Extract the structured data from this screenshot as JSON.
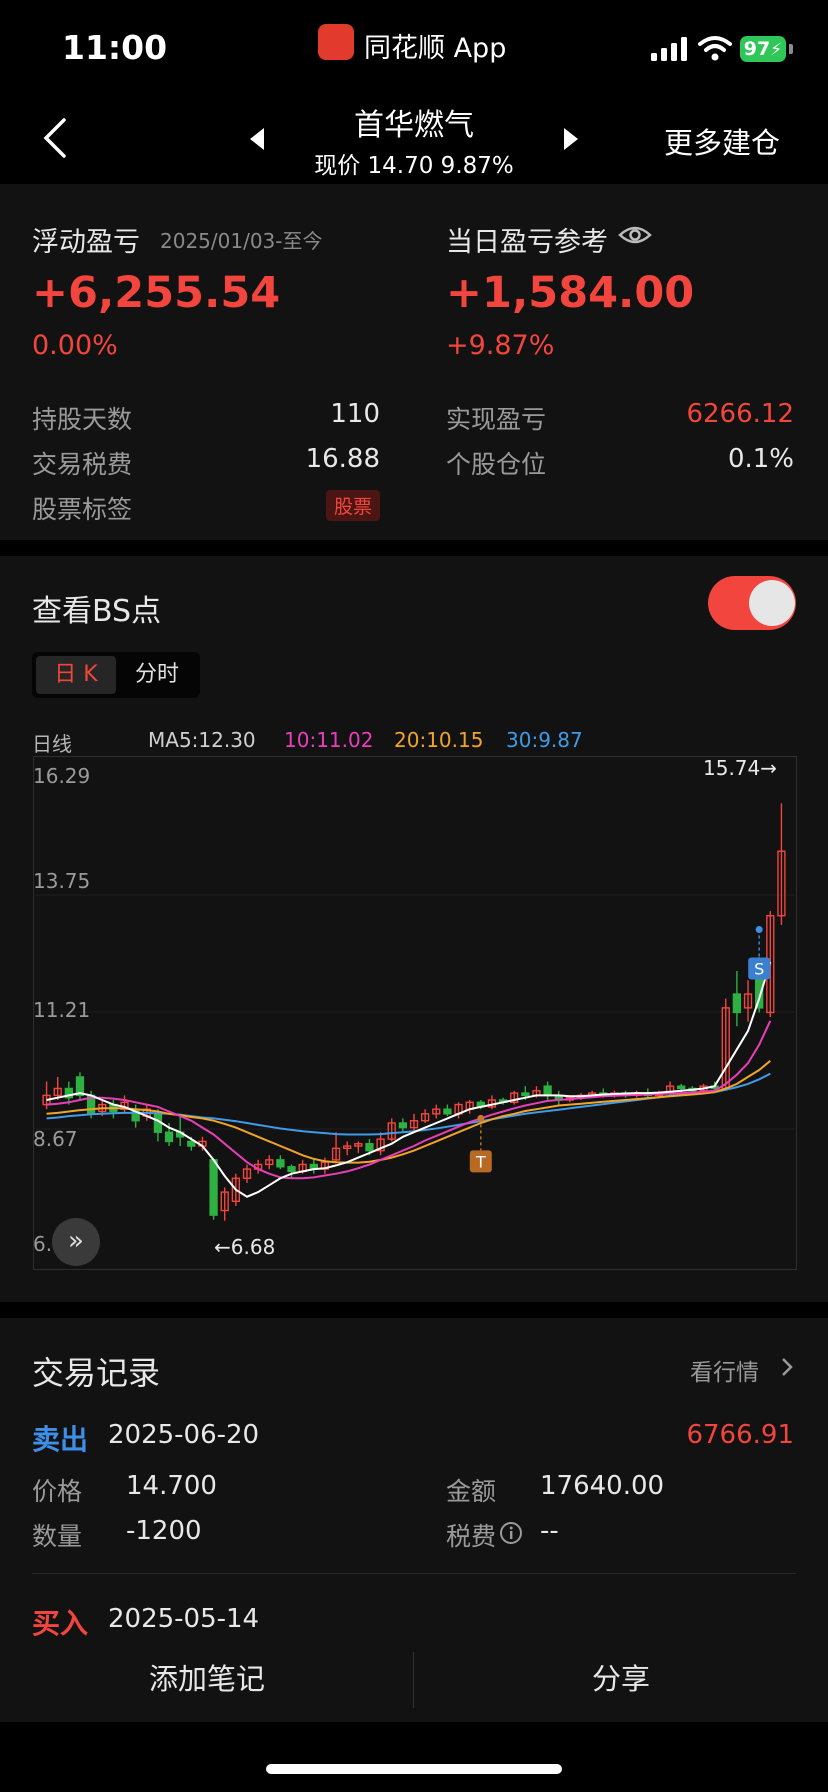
{
  "status": {
    "time": "11:00",
    "app_name": "同花顺 App",
    "battery": "97"
  },
  "nav": {
    "title": "首华燃气",
    "subtitle": "现价 14.70 9.87%",
    "more": "更多建仓"
  },
  "summary": {
    "float_label": "浮动盈亏",
    "date_range": "2025/01/03-至今",
    "float_value": "+6,255.54",
    "float_pct": "0.00%",
    "day_label": "当日盈亏参考",
    "day_value": "+1,584.00",
    "day_pct": "+9.87%",
    "rows_left": [
      {
        "label": "持股天数",
        "value": "110"
      },
      {
        "label": "交易税费",
        "value": "16.88"
      },
      {
        "label": "股票标签",
        "value": "股票"
      }
    ],
    "rows_right": [
      {
        "label": "实现盈亏",
        "value": "6266.12"
      },
      {
        "label": "个股仓位",
        "value": "0.1%"
      }
    ]
  },
  "bs": {
    "title": "查看BS点",
    "toggle_on": true,
    "tab_k": "日 K",
    "tab_time": "分时"
  },
  "ma": {
    "period": "日线",
    "ma5": "MA5:12.30",
    "ma10": "10:11.02",
    "ma20": "20:10.15",
    "ma30": "30:9.87"
  },
  "colors": {
    "up": "#f2453d",
    "down": "#2fb043",
    "ma5": "#ffffff",
    "ma10": "#e83fb8",
    "ma20": "#f0a42a",
    "ma30": "#3f9be8"
  },
  "chart_data": {
    "type": "candlestick",
    "y_ticks": [
      "16.29",
      "13.75",
      "11.21",
      "8.67",
      "6.1"
    ],
    "ylim": [
      6.13,
      16.29
    ],
    "high_label": "15.74→",
    "low_label": "←6.68",
    "markers": [
      {
        "label": "T",
        "index": 39,
        "price": 8.9
      },
      {
        "label": "S",
        "index": 64,
        "price": 13.0
      }
    ],
    "candles": [
      {
        "o": 9.2,
        "c": 9.4,
        "h": 9.7,
        "l": 9.1
      },
      {
        "o": 9.4,
        "c": 9.55,
        "h": 9.8,
        "l": 9.3
      },
      {
        "o": 9.55,
        "c": 9.35,
        "h": 9.7,
        "l": 9.2
      },
      {
        "o": 9.8,
        "c": 9.4,
        "h": 9.9,
        "l": 9.3
      },
      {
        "o": 9.4,
        "c": 9.0,
        "h": 9.5,
        "l": 8.9
      },
      {
        "o": 9.05,
        "c": 9.2,
        "h": 9.3,
        "l": 8.95
      },
      {
        "o": 9.2,
        "c": 9.05,
        "h": 9.3,
        "l": 8.9
      },
      {
        "o": 9.1,
        "c": 9.25,
        "h": 9.4,
        "l": 9.0
      },
      {
        "o": 9.1,
        "c": 8.85,
        "h": 9.2,
        "l": 8.7
      },
      {
        "o": 8.95,
        "c": 9.1,
        "h": 9.2,
        "l": 8.85
      },
      {
        "o": 9.0,
        "c": 8.6,
        "h": 9.1,
        "l": 8.4
      },
      {
        "o": 8.6,
        "c": 8.4,
        "h": 8.8,
        "l": 8.3
      },
      {
        "o": 8.6,
        "c": 8.5,
        "h": 9.0,
        "l": 8.3
      },
      {
        "o": 8.4,
        "c": 8.3,
        "h": 8.5,
        "l": 8.2
      },
      {
        "o": 8.3,
        "c": 8.4,
        "h": 8.5,
        "l": 8.2
      },
      {
        "o": 8.0,
        "c": 6.8,
        "h": 8.0,
        "l": 6.7
      },
      {
        "o": 6.9,
        "c": 7.3,
        "h": 7.4,
        "l": 6.68
      },
      {
        "o": 7.1,
        "c": 7.6,
        "h": 7.7,
        "l": 7.0
      },
      {
        "o": 7.6,
        "c": 7.8,
        "h": 7.9,
        "l": 7.5
      },
      {
        "o": 7.8,
        "c": 7.9,
        "h": 8.0,
        "l": 7.7
      },
      {
        "o": 7.9,
        "c": 8.0,
        "h": 8.1,
        "l": 7.8
      },
      {
        "o": 8.0,
        "c": 7.85,
        "h": 8.1,
        "l": 7.8
      },
      {
        "o": 7.85,
        "c": 7.75,
        "h": 7.9,
        "l": 7.6
      },
      {
        "o": 7.75,
        "c": 7.9,
        "h": 8.0,
        "l": 7.7
      },
      {
        "o": 7.9,
        "c": 7.8,
        "h": 8.0,
        "l": 7.7
      },
      {
        "o": 7.8,
        "c": 7.95,
        "h": 8.05,
        "l": 7.7
      },
      {
        "o": 8.0,
        "c": 8.25,
        "h": 8.6,
        "l": 7.95
      },
      {
        "o": 8.25,
        "c": 8.3,
        "h": 8.4,
        "l": 8.1
      },
      {
        "o": 8.3,
        "c": 8.35,
        "h": 8.4,
        "l": 8.15
      },
      {
        "o": 8.35,
        "c": 8.2,
        "h": 8.45,
        "l": 8.1
      },
      {
        "o": 8.2,
        "c": 8.45,
        "h": 8.6,
        "l": 8.1
      },
      {
        "o": 8.45,
        "c": 8.8,
        "h": 8.9,
        "l": 8.4
      },
      {
        "o": 8.8,
        "c": 8.7,
        "h": 8.9,
        "l": 8.6
      },
      {
        "o": 8.7,
        "c": 8.85,
        "h": 9.0,
        "l": 8.6
      },
      {
        "o": 8.85,
        "c": 9.0,
        "h": 9.1,
        "l": 8.8
      },
      {
        "o": 9.0,
        "c": 9.1,
        "h": 9.2,
        "l": 8.9
      },
      {
        "o": 9.1,
        "c": 9.0,
        "h": 9.2,
        "l": 8.95
      },
      {
        "o": 9.0,
        "c": 9.2,
        "h": 9.25,
        "l": 8.9
      },
      {
        "o": 9.1,
        "c": 9.25,
        "h": 9.3,
        "l": 9.0
      },
      {
        "o": 9.25,
        "c": 9.15,
        "h": 9.3,
        "l": 9.1
      },
      {
        "o": 9.15,
        "c": 9.3,
        "h": 9.4,
        "l": 9.1
      },
      {
        "o": 9.3,
        "c": 9.25,
        "h": 9.35,
        "l": 9.2
      },
      {
        "o": 9.25,
        "c": 9.45,
        "h": 9.5,
        "l": 9.2
      },
      {
        "o": 9.45,
        "c": 9.4,
        "h": 9.6,
        "l": 9.3
      },
      {
        "o": 9.4,
        "c": 9.5,
        "h": 9.6,
        "l": 9.35
      },
      {
        "o": 9.6,
        "c": 9.4,
        "h": 9.7,
        "l": 9.3
      },
      {
        "o": 9.4,
        "c": 9.3,
        "h": 9.5,
        "l": 9.2
      },
      {
        "o": 9.3,
        "c": 9.35,
        "h": 9.4,
        "l": 9.25
      },
      {
        "o": 9.35,
        "c": 9.4,
        "h": 9.45,
        "l": 9.3
      },
      {
        "o": 9.4,
        "c": 9.45,
        "h": 9.5,
        "l": 9.35
      },
      {
        "o": 9.45,
        "c": 9.4,
        "h": 9.55,
        "l": 9.35
      },
      {
        "o": 9.4,
        "c": 9.45,
        "h": 9.5,
        "l": 9.35
      },
      {
        "o": 9.45,
        "c": 9.4,
        "h": 9.5,
        "l": 9.35
      },
      {
        "o": 9.4,
        "c": 9.45,
        "h": 9.5,
        "l": 9.35
      },
      {
        "o": 9.45,
        "c": 9.4,
        "h": 9.55,
        "l": 9.35
      },
      {
        "o": 9.4,
        "c": 9.45,
        "h": 9.5,
        "l": 9.35
      },
      {
        "o": 9.45,
        "c": 9.6,
        "h": 9.7,
        "l": 9.4
      },
      {
        "o": 9.6,
        "c": 9.55,
        "h": 9.65,
        "l": 9.45
      },
      {
        "o": 9.55,
        "c": 9.5,
        "h": 9.6,
        "l": 9.45
      },
      {
        "o": 9.5,
        "c": 9.6,
        "h": 9.65,
        "l": 9.45
      },
      {
        "o": 9.6,
        "c": 9.55,
        "h": 9.7,
        "l": 9.5
      },
      {
        "o": 9.55,
        "c": 11.3,
        "h": 11.5,
        "l": 9.5
      },
      {
        "o": 11.6,
        "c": 11.2,
        "h": 12.1,
        "l": 10.9
      },
      {
        "o": 11.3,
        "c": 11.6,
        "h": 11.9,
        "l": 11.0
      },
      {
        "o": 12.1,
        "c": 11.3,
        "h": 12.4,
        "l": 11.2
      },
      {
        "o": 11.2,
        "c": 13.3,
        "h": 13.4,
        "l": 11.1
      },
      {
        "o": 13.3,
        "c": 14.7,
        "h": 15.74,
        "l": 13.1
      }
    ],
    "ma5": [
      9.3,
      9.35,
      9.4,
      9.45,
      9.4,
      9.3,
      9.2,
      9.15,
      9.05,
      8.95,
      8.85,
      8.7,
      8.6,
      8.45,
      8.3,
      8.0,
      7.65,
      7.35,
      7.2,
      7.3,
      7.45,
      7.6,
      7.7,
      7.75,
      7.8,
      7.82,
      7.88,
      7.95,
      8.05,
      8.15,
      8.25,
      8.35,
      8.5,
      8.6,
      8.7,
      8.8,
      8.9,
      9.0,
      9.1,
      9.15,
      9.2,
      9.25,
      9.3,
      9.35,
      9.4,
      9.4,
      9.4,
      9.38,
      9.38,
      9.4,
      9.42,
      9.43,
      9.44,
      9.45,
      9.45,
      9.46,
      9.48,
      9.5,
      9.52,
      9.55,
      9.6,
      10.0,
      10.4,
      10.8,
      11.5,
      12.3
    ],
    "ma10": [
      9.2,
      9.22,
      9.25,
      9.3,
      9.35,
      9.35,
      9.33,
      9.3,
      9.25,
      9.2,
      9.15,
      9.05,
      8.95,
      8.85,
      8.7,
      8.55,
      8.35,
      8.15,
      7.95,
      7.8,
      7.7,
      7.62,
      7.6,
      7.6,
      7.62,
      7.66,
      7.7,
      7.75,
      7.82,
      7.9,
      8.0,
      8.1,
      8.2,
      8.3,
      8.42,
      8.52,
      8.62,
      8.72,
      8.82,
      8.9,
      8.98,
      9.05,
      9.12,
      9.18,
      9.23,
      9.28,
      9.3,
      9.32,
      9.34,
      9.36,
      9.38,
      9.39,
      9.4,
      9.41,
      9.42,
      9.43,
      9.44,
      9.45,
      9.46,
      9.48,
      9.5,
      9.65,
      9.85,
      10.1,
      10.5,
      11.02
    ],
    "ma20": [
      9.0,
      9.02,
      9.05,
      9.08,
      9.1,
      9.12,
      9.12,
      9.12,
      9.1,
      9.08,
      9.05,
      9.0,
      8.97,
      8.93,
      8.9,
      8.85,
      8.78,
      8.7,
      8.6,
      8.5,
      8.4,
      8.3,
      8.2,
      8.1,
      8.02,
      7.97,
      7.95,
      7.94,
      7.94,
      7.96,
      8.0,
      8.05,
      8.12,
      8.2,
      8.3,
      8.4,
      8.5,
      8.6,
      8.7,
      8.8,
      8.88,
      8.95,
      9.0,
      9.06,
      9.1,
      9.14,
      9.18,
      9.2,
      9.22,
      9.24,
      9.26,
      9.28,
      9.3,
      9.32,
      9.34,
      9.36,
      9.38,
      9.4,
      9.42,
      9.44,
      9.47,
      9.55,
      9.65,
      9.8,
      9.95,
      10.15
    ],
    "ma30": [
      8.9,
      8.92,
      8.95,
      8.97,
      8.99,
      9.0,
      9.01,
      9.02,
      9.02,
      9.02,
      9.01,
      9.0,
      8.98,
      8.95,
      8.92,
      8.9,
      8.87,
      8.84,
      8.8,
      8.76,
      8.72,
      8.68,
      8.65,
      8.62,
      8.6,
      8.58,
      8.56,
      8.55,
      8.55,
      8.55,
      8.56,
      8.58,
      8.6,
      8.62,
      8.65,
      8.68,
      8.72,
      8.76,
      8.8,
      8.84,
      8.88,
      8.92,
      8.96,
      9.0,
      9.03,
      9.06,
      9.09,
      9.12,
      9.15,
      9.18,
      9.21,
      9.24,
      9.27,
      9.3,
      9.33,
      9.36,
      9.39,
      9.41,
      9.43,
      9.45,
      9.47,
      9.52,
      9.58,
      9.65,
      9.75,
      9.87
    ]
  },
  "trades": {
    "title": "交易记录",
    "market_link": "看行情",
    "sell": {
      "type": "卖出",
      "date": "2025-06-20",
      "amount_value": "6766.91",
      "price_label": "价格",
      "price": "14.700",
      "total_label": "金额",
      "total": "17640.00",
      "qty_label": "数量",
      "qty": "-1200",
      "fee_label": "税费",
      "fee": "--"
    },
    "buy": {
      "type": "买入",
      "date": "2025-05-14"
    }
  },
  "bottom": {
    "add_note": "添加笔记",
    "share": "分享"
  }
}
